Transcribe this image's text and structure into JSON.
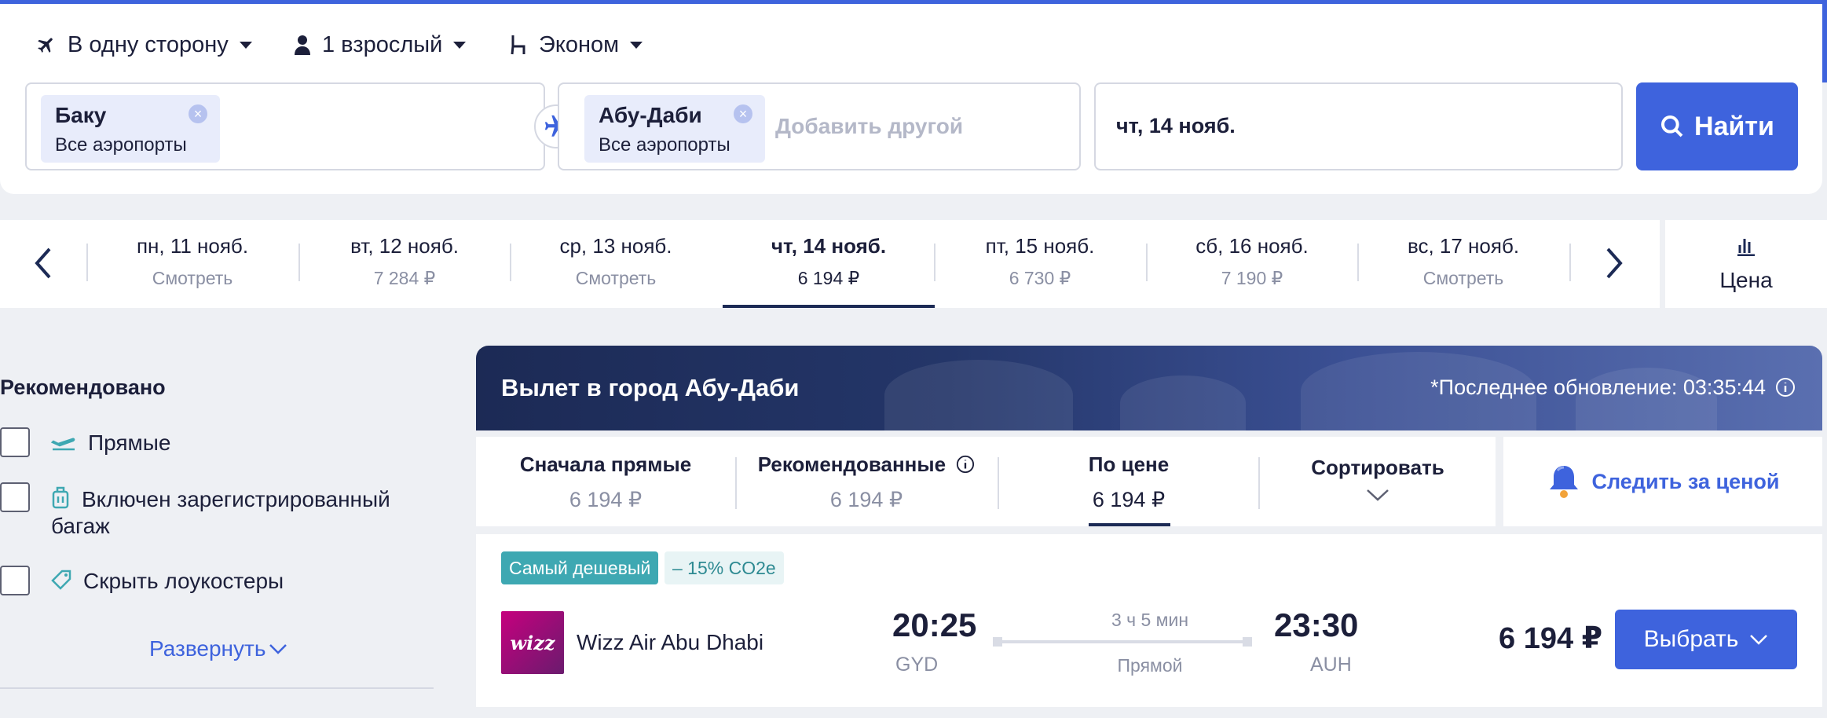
{
  "search": {
    "trip_type": "В одну сторону",
    "passengers": "1 взрослый",
    "cabin_class": "Эконом",
    "origin": {
      "city": "Баку",
      "airports": "Все аэропорты"
    },
    "destination": {
      "city": "Абу-Даби",
      "airports": "Все аэропорты"
    },
    "add_other_placeholder": "Добавить другой",
    "date": "чт, 14 нояб.",
    "find_label": "Найти"
  },
  "date_strip": {
    "days": [
      {
        "date": "пн, 11 нояб.",
        "price": "Смотреть"
      },
      {
        "date": "вт, 12 нояб.",
        "price": "7 284 ₽"
      },
      {
        "date": "ср, 13 нояб.",
        "price": "Смотреть"
      },
      {
        "date": "чт, 14 нояб.",
        "price": "6 194 ₽",
        "selected": true
      },
      {
        "date": "пт, 15 нояб.",
        "price": "6 730 ₽"
      },
      {
        "date": "сб, 16 нояб.",
        "price": "7 190 ₽"
      },
      {
        "date": "вс, 17 нояб.",
        "price": "Смотреть"
      }
    ],
    "price_toggle_label": "Цена"
  },
  "filters": {
    "title": "Рекомендовано",
    "items": [
      {
        "label": "Прямые",
        "icon": "plane-takeoff-icon",
        "checked": false
      },
      {
        "label": "Включен зарегистрированный",
        "label_line2": "багаж",
        "icon": "luggage-icon",
        "checked": false
      },
      {
        "label": "Скрыть лоукостеры",
        "icon": "tag-icon",
        "checked": false
      }
    ],
    "expand_label": "Развернуть"
  },
  "results": {
    "banner_title": "Вылет в город Абу-Даби",
    "last_update": "*Последнее обновление: 03:35:44",
    "sort_options": [
      {
        "name": "Сначала прямые",
        "value": "6 194 ₽"
      },
      {
        "name": "Рекомендованные",
        "value": "6 194 ₽",
        "info": true
      },
      {
        "name": "По цене",
        "value": "6 194 ₽",
        "active": true
      },
      {
        "name": "Сортировать",
        "value": ""
      }
    ],
    "track_price_label": "Следить за ценой",
    "flights": [
      {
        "badge_cheapest": "Самый дешевый",
        "badge_co2": "– 15% CO2e",
        "airline": "Wizz Air Abu Dhabi",
        "logo_text": "wizz",
        "dep_time": "20:25",
        "dep_airport": "GYD",
        "duration": "3 ч 5 мин",
        "stops": "Прямой",
        "arr_time": "23:30",
        "arr_airport": "AUH",
        "price": "6 194 ₽",
        "select_label": "Выбрать"
      }
    ]
  },
  "colors": {
    "accent": "#3e63dd",
    "navy": "#1c2a55",
    "badge_teal": "#3ea8b2"
  }
}
